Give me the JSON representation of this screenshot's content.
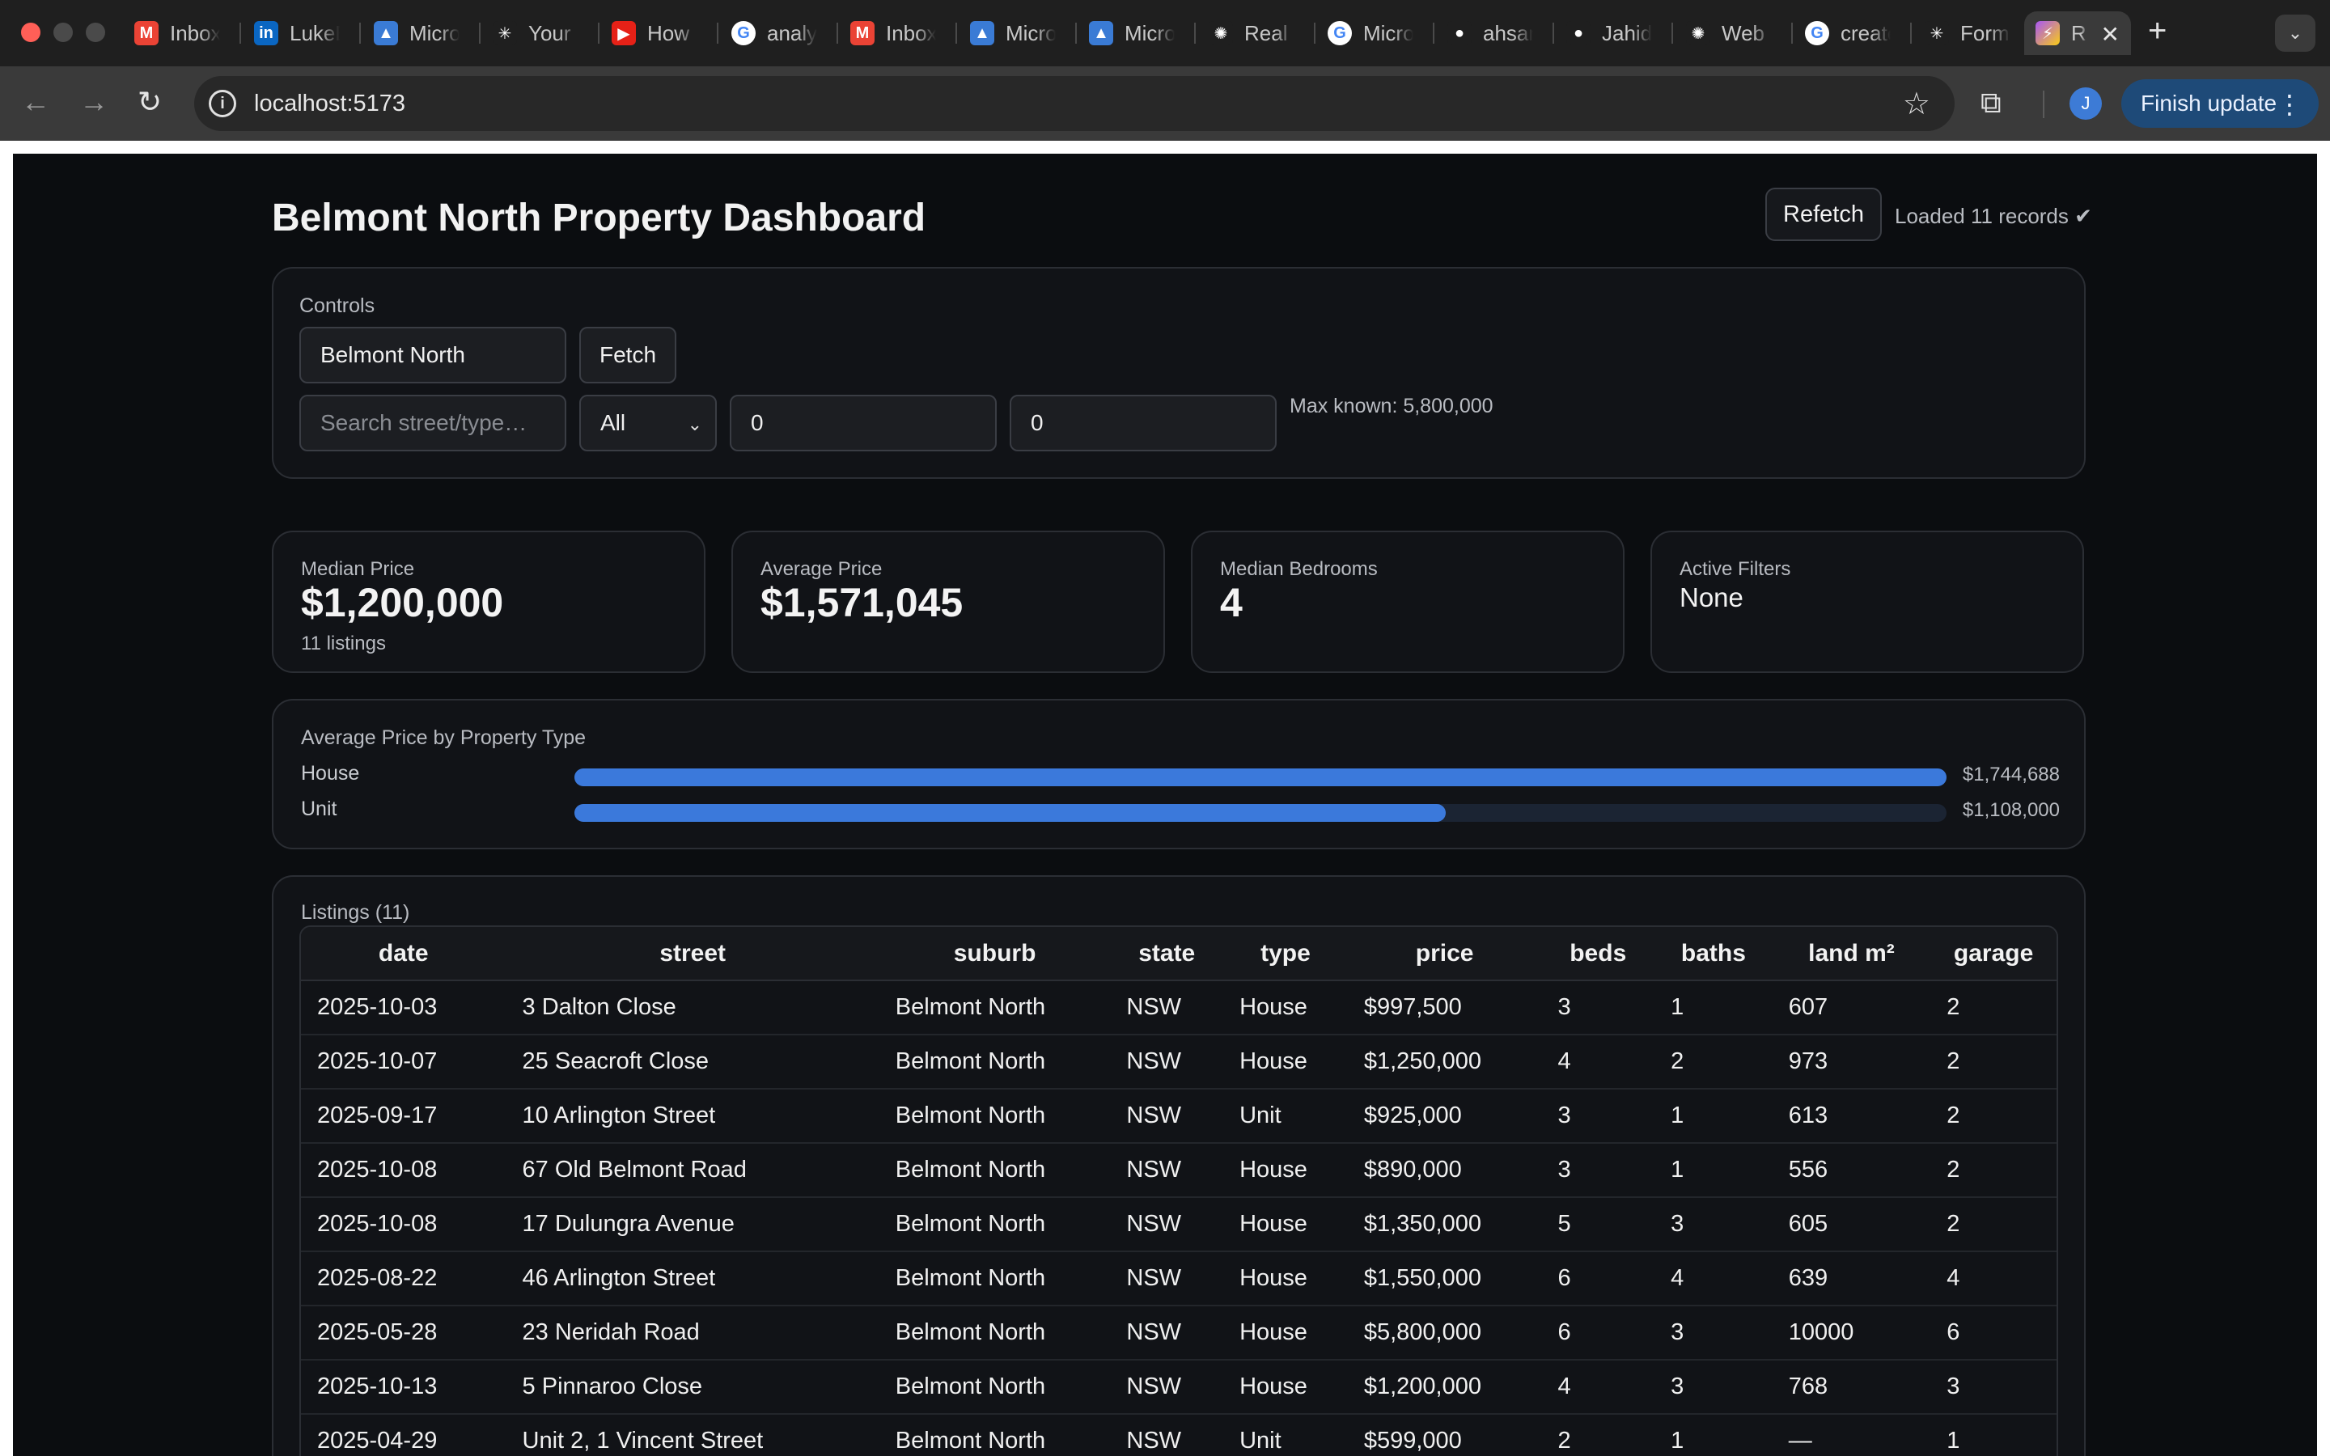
{
  "browser": {
    "tabs": [
      {
        "title": "Inbox",
        "icon": "gmail-icon",
        "color": "#ea4335",
        "glyph": "M"
      },
      {
        "title": "LukeBurgess",
        "icon": "linkedin-icon",
        "color": "#0a66c2",
        "glyph": "in"
      },
      {
        "title": "Microsoft",
        "icon": "azure-icon",
        "color": "#3a7bd5",
        "glyph": "▲"
      },
      {
        "title": "Your",
        "icon": "perplexity-icon",
        "color": "#1f1f1f",
        "glyph": "✳"
      },
      {
        "title": "How",
        "icon": "youtube-icon",
        "color": "#e62117",
        "glyph": "▶"
      },
      {
        "title": "analytics",
        "icon": "google-icon",
        "color": "#ffffff",
        "glyph": "G"
      },
      {
        "title": "Inbox",
        "icon": "gmail-icon",
        "color": "#ea4335",
        "glyph": "M"
      },
      {
        "title": "Microsoft",
        "icon": "azure-icon",
        "color": "#3a7bd5",
        "glyph": "▲"
      },
      {
        "title": "Microsoft",
        "icon": "azure-icon",
        "color": "#3a7bd5",
        "glyph": "▲"
      },
      {
        "title": "Real",
        "icon": "openai-icon",
        "color": "#1f1f1f",
        "glyph": "✺"
      },
      {
        "title": "Microsoft",
        "icon": "google-icon",
        "color": "#ffffff",
        "glyph": "G"
      },
      {
        "title": "ahsan",
        "icon": "github-icon",
        "color": "#1f1f1f",
        "glyph": "●"
      },
      {
        "title": "Jahid",
        "icon": "github-icon",
        "color": "#1f1f1f",
        "glyph": "●"
      },
      {
        "title": "Web",
        "icon": "openai-icon",
        "color": "#1f1f1f",
        "glyph": "✺"
      },
      {
        "title": "create",
        "icon": "google-icon",
        "color": "#ffffff",
        "glyph": "G"
      },
      {
        "title": "Form",
        "icon": "perplexity-icon",
        "color": "#1f1f1f",
        "glyph": "✳"
      }
    ],
    "active_tab": {
      "title": "R",
      "icon": "vite-icon"
    },
    "url": "localhost:5173",
    "finish_update": "Finish update",
    "avatar_letter": "J"
  },
  "app": {
    "title": "Belmont North Property Dashboard",
    "refetch_label": "Refetch",
    "loaded_status": "Loaded 11 records ✔",
    "controls": {
      "label": "Controls",
      "suburb_value": "Belmont North",
      "fetch_label": "Fetch",
      "search_placeholder": "Search street/type…",
      "type_selected": "All",
      "min_price": "0",
      "max_price": "0",
      "max_known": "Max known: 5,800,000"
    },
    "stats": [
      {
        "label": "Median Price",
        "value": "$1,200,000",
        "sub": "11 listings"
      },
      {
        "label": "Average Price",
        "value": "$1,571,045",
        "sub": ""
      },
      {
        "label": "Median Bedrooms",
        "value": "4",
        "sub": ""
      },
      {
        "label": "Active Filters",
        "value": "None",
        "sub": ""
      }
    ],
    "listings_label": "Listings (11)",
    "columns": [
      "date",
      "street",
      "suburb",
      "state",
      "type",
      "price",
      "beds",
      "baths",
      "land m²",
      "garage"
    ],
    "rows": [
      [
        "2025-10-03",
        "3 Dalton Close",
        "Belmont North",
        "NSW",
        "House",
        "$997,500",
        "3",
        "1",
        "607",
        "2"
      ],
      [
        "2025-10-07",
        "25 Seacroft Close",
        "Belmont North",
        "NSW",
        "House",
        "$1,250,000",
        "4",
        "2",
        "973",
        "2"
      ],
      [
        "2025-09-17",
        "10 Arlington Street",
        "Belmont North",
        "NSW",
        "Unit",
        "$925,000",
        "3",
        "1",
        "613",
        "2"
      ],
      [
        "2025-10-08",
        "67 Old Belmont Road",
        "Belmont North",
        "NSW",
        "House",
        "$890,000",
        "3",
        "1",
        "556",
        "2"
      ],
      [
        "2025-10-08",
        "17 Dulungra Avenue",
        "Belmont North",
        "NSW",
        "House",
        "$1,350,000",
        "5",
        "3",
        "605",
        "2"
      ],
      [
        "2025-08-22",
        "46 Arlington Street",
        "Belmont North",
        "NSW",
        "House",
        "$1,550,000",
        "6",
        "4",
        "639",
        "4"
      ],
      [
        "2025-05-28",
        "23 Neridah Road",
        "Belmont North",
        "NSW",
        "House",
        "$5,800,000",
        "6",
        "3",
        "10000",
        "6"
      ],
      [
        "2025-10-13",
        "5 Pinnaroo Close",
        "Belmont North",
        "NSW",
        "House",
        "$1,200,000",
        "4",
        "3",
        "768",
        "3"
      ],
      [
        "2025-04-29",
        "Unit 2, 1 Vincent Street",
        "Belmont North",
        "NSW",
        "Unit",
        "$599,000",
        "2",
        "1",
        "—",
        "1"
      ]
    ]
  },
  "chart_data": {
    "type": "bar",
    "orientation": "horizontal",
    "title": "Average Price by Property Type",
    "categories": [
      "House",
      "Unit"
    ],
    "values": [
      1744688,
      1108000
    ],
    "value_labels": [
      "$1,744,688",
      "$1,108,000"
    ],
    "xlim": [
      0,
      1744688
    ],
    "bar_color": "#3b79db",
    "track_color": "#1b2433"
  }
}
